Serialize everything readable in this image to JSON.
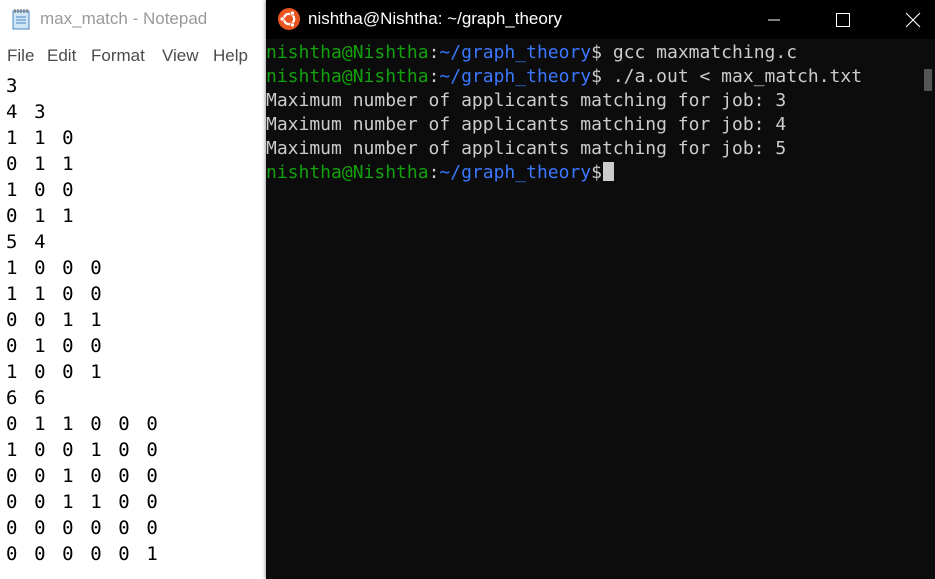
{
  "notepad": {
    "title": "max_match - Notepad",
    "icon": "notepad-icon",
    "menu": [
      "File",
      "Edit",
      "Format",
      "View",
      "Help"
    ],
    "lines": [
      "3",
      "4 3",
      "1 1 0",
      "0 1 1",
      "1 0 0",
      "0 1 1",
      "5 4",
      "1 0 0 0",
      "1 1 0 0",
      "0 0 1 1",
      "0 1 0 0",
      "1 0 0 1",
      "6 6",
      "0 1 1 0 0 0",
      "1 0 0 1 0 0",
      "0 0 1 0 0 0",
      "0 0 1 1 0 0",
      "0 0 0 0 0 0",
      "0 0 0 0 0 1"
    ]
  },
  "terminal": {
    "title": "nishtha@Nishtha: ~/graph_theory",
    "icon": "ubuntu-icon",
    "window_buttons": [
      "minimize-icon",
      "maximize-icon",
      "close-icon"
    ],
    "prompt_user": "nishtha@Nishtha",
    "prompt_colon": ":",
    "prompt_path": "~/graph_theory",
    "prompt_symbol": "$",
    "commands": [
      "gcc maxmatching.c",
      "./a.out < max_match.txt"
    ],
    "output": [
      "Maximum number of applicants matching for job: 3",
      "Maximum number of applicants matching for job: 4",
      "Maximum number of applicants matching for job: 5"
    ]
  },
  "colors": {
    "terminal_bg": "#0c0c0c",
    "prompt_user": "#13a10e",
    "prompt_path": "#3b78ff",
    "text": "#cccccc",
    "ubuntu_orange": "#e95420"
  }
}
